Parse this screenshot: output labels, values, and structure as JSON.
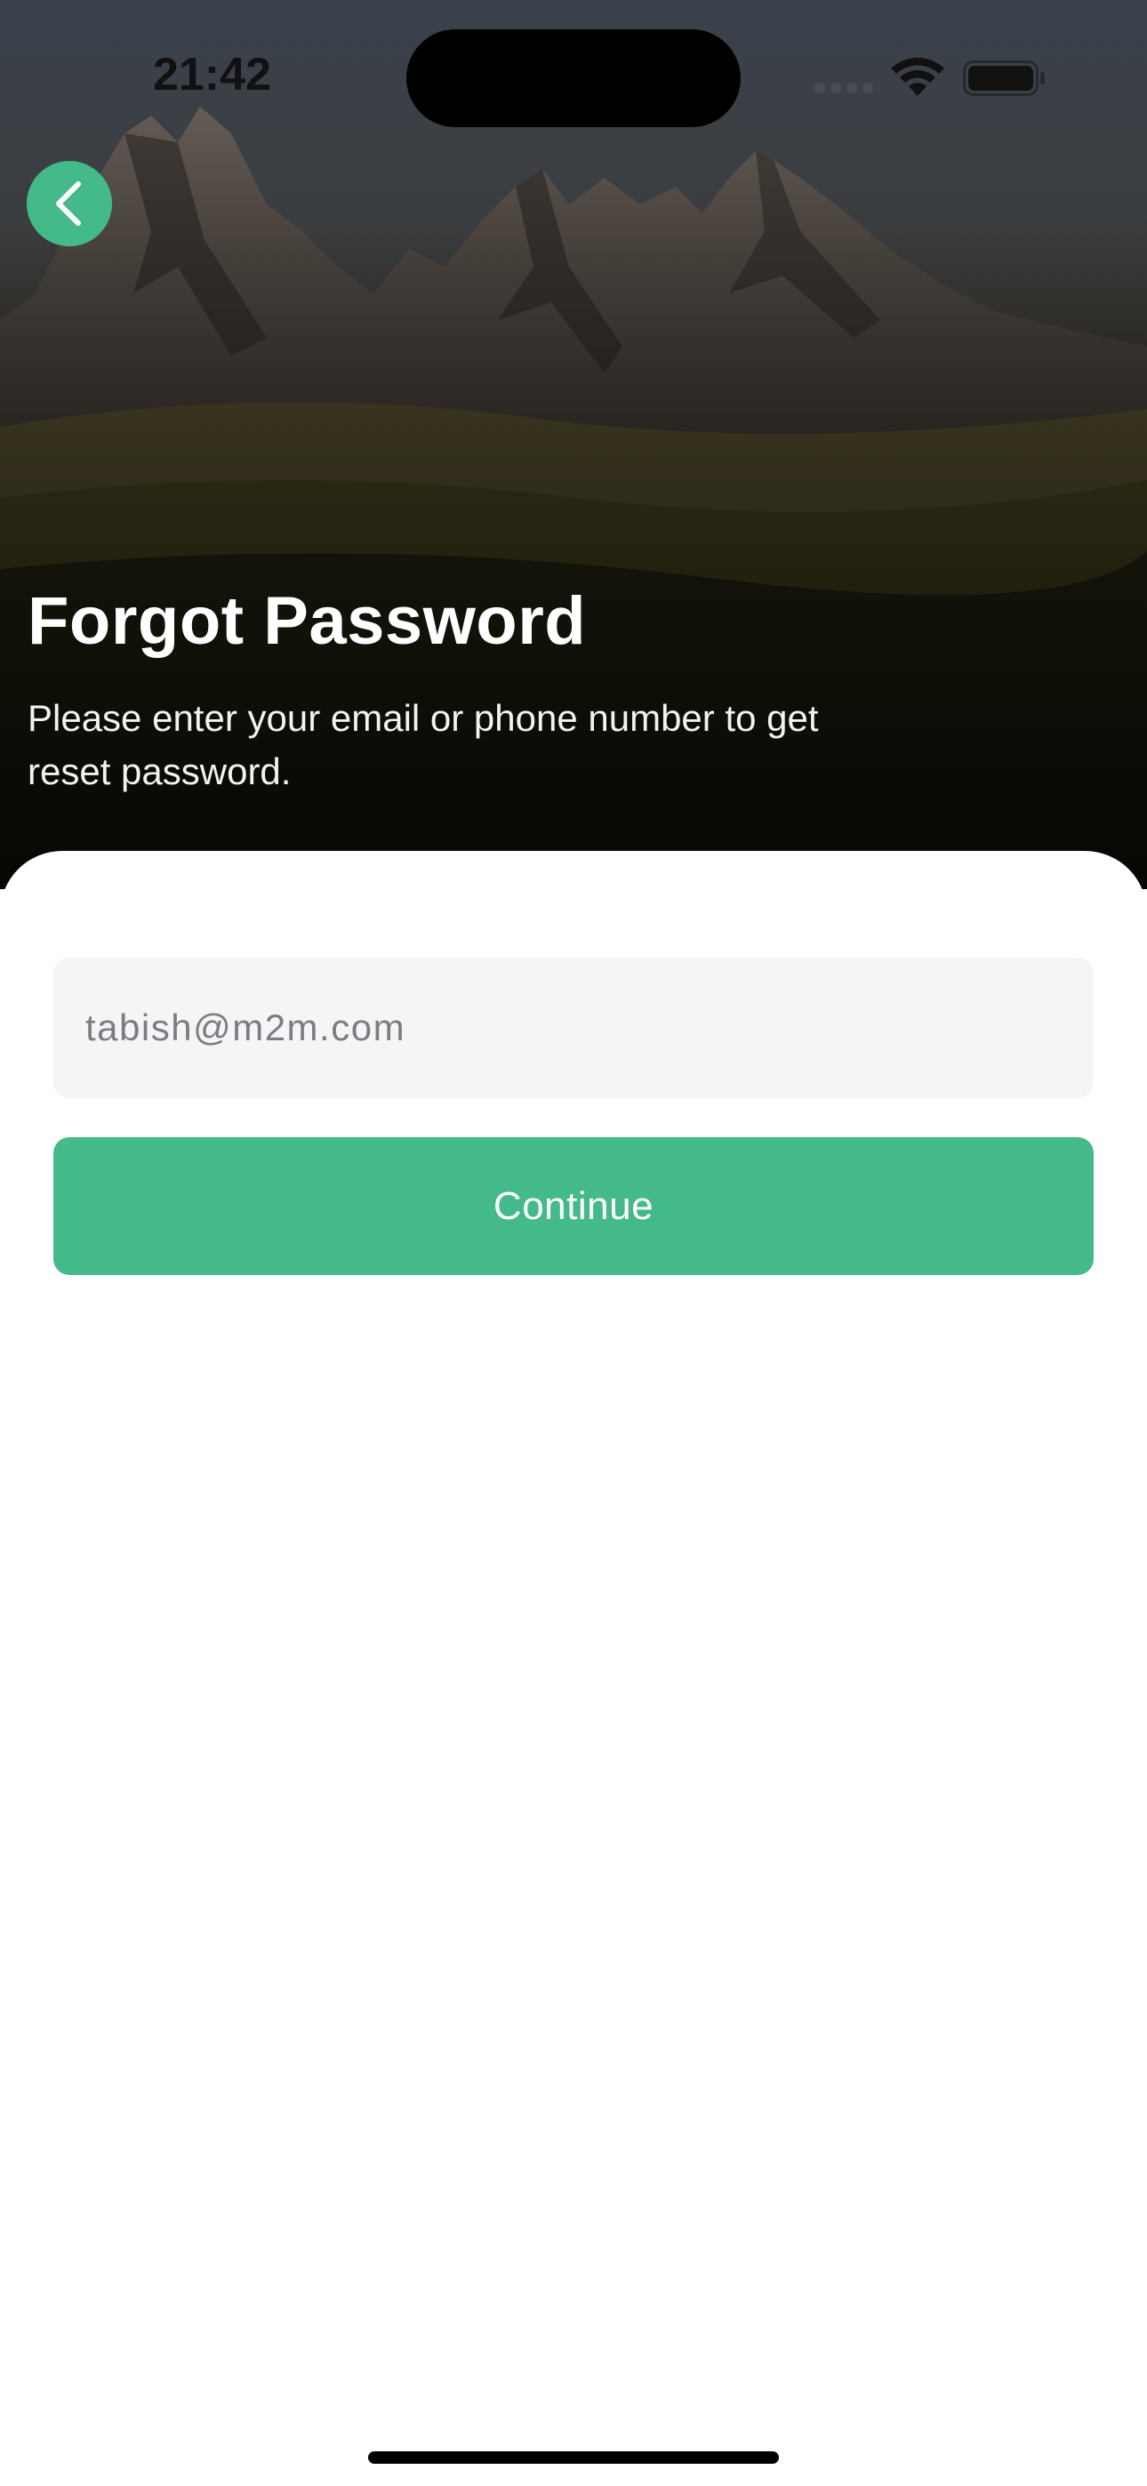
{
  "status_bar": {
    "time": "21:42"
  },
  "header": {
    "back_icon": "chevron-left-icon",
    "title": "Forgot Password",
    "subtitle": "Please enter your email or phone number to get reset password."
  },
  "form": {
    "email_placeholder": "tabish@m2m.com",
    "continue_label": "Continue"
  },
  "colors": {
    "accent": "#44b98a",
    "field_background": "#f5f5f5"
  }
}
